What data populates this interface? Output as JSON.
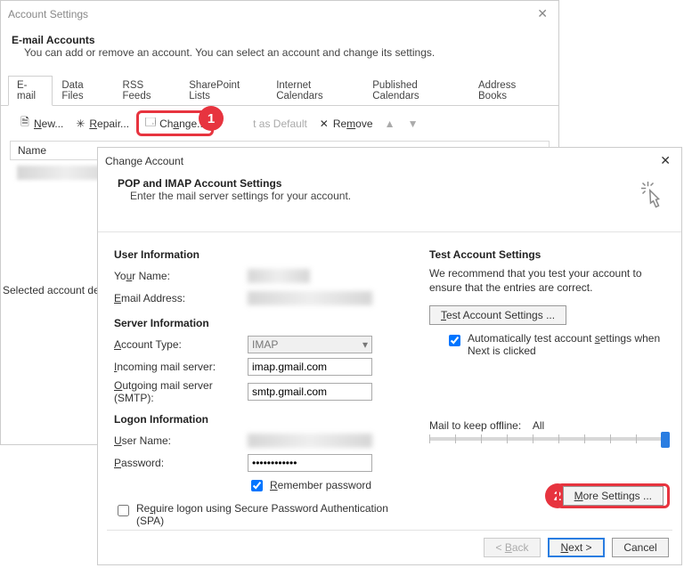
{
  "acct_win": {
    "title": "Account Settings",
    "heading": "E-mail Accounts",
    "desc": "You can add or remove an account. You can select an account and change its settings.",
    "tabs": [
      "E-mail",
      "Data Files",
      "RSS Feeds",
      "SharePoint Lists",
      "Internet Calendars",
      "Published Calendars",
      "Address Books"
    ],
    "toolbar": {
      "new": "New...",
      "repair": "Repair...",
      "change": "Change...",
      "set_default": "Set as Default",
      "remove": "Remove"
    },
    "col_name": "Name",
    "sel_label": "Selected account de"
  },
  "chg_win": {
    "title": "Change Account",
    "heading": "POP and IMAP Account Settings",
    "desc": "Enter the mail server settings for your account.",
    "sec_user": "User Information",
    "your_name": "Your Name:",
    "email": "Email Address:",
    "sec_server": "Server Information",
    "acct_type": "Account Type:",
    "acct_type_val": "IMAP",
    "incoming": "Incoming mail server:",
    "incoming_val": "imap.gmail.com",
    "outgoing": "Outgoing mail server (SMTP):",
    "outgoing_val": "smtp.gmail.com",
    "sec_logon": "Logon Information",
    "user": "User Name:",
    "password": "Password:",
    "password_val": "************",
    "remember": "Remember password",
    "spa": "Require logon using Secure Password Authentication (SPA)",
    "test_head": "Test Account Settings",
    "test_desc": "We recommend that you test your account to ensure that the entries are correct.",
    "test_btn": "Test Account Settings ...",
    "auto_test": "Automatically test account settings when Next is clicked",
    "mail_keep": "Mail to keep offline:",
    "mail_keep_val": "All",
    "more": "More Settings ...",
    "back": "< Back",
    "next": "Next >",
    "cancel": "Cancel"
  },
  "callouts": {
    "n1": "1",
    "n2": "2"
  }
}
